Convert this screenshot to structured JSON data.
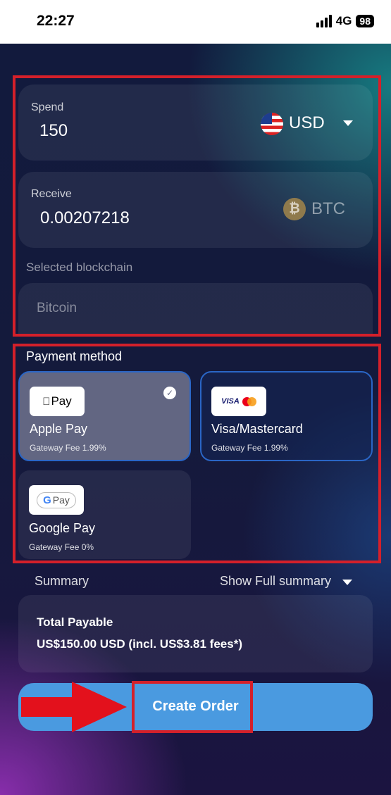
{
  "status_bar": {
    "time": "22:27",
    "network": "4G",
    "battery": "98"
  },
  "exchange": {
    "spend": {
      "label": "Spend",
      "value": "150",
      "currency": "USD"
    },
    "receive": {
      "label": "Receive",
      "value": "0.00207218",
      "currency": "BTC"
    },
    "blockchain": {
      "label": "Selected blockchain",
      "value": "Bitcoin"
    }
  },
  "payment": {
    "title": "Payment method",
    "methods": [
      {
        "logo": "Pay",
        "name": "Apple Pay",
        "fee": "Gateway Fee 1.99%",
        "selected": true
      },
      {
        "logo": "VISA",
        "name": "Visa/Mastercard",
        "fee": "Gateway Fee 1.99%",
        "selected": false
      },
      {
        "logo": "Pay",
        "name": "Google Pay",
        "fee": "Gateway Fee 0%",
        "selected": false
      }
    ]
  },
  "summary": {
    "label": "Summary",
    "toggle": "Show Full summary",
    "total_label": "Total Payable",
    "total_value": "US$150.00 USD (incl. US$3.81 fees*)"
  },
  "cta": {
    "label": "Create Order"
  },
  "colors": {
    "highlight": "#d4202a",
    "button": "#4a9ae0",
    "selected_card": "#626682",
    "card_border": "#2a66c6"
  }
}
